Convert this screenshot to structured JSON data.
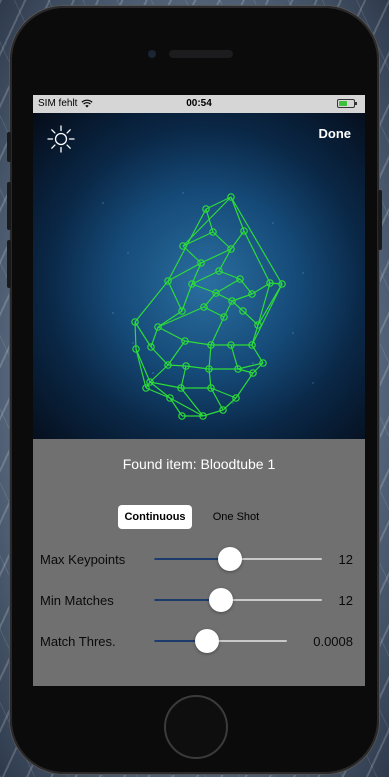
{
  "status_bar": {
    "carrier": "SIM fehlt",
    "time": "00:54"
  },
  "top_bar": {
    "brightness_icon": "sun-icon",
    "done_label": "Done"
  },
  "result": {
    "found_text": "Found item: Bloodtube 1"
  },
  "mode": {
    "options": [
      "Continuous",
      "One Shot"
    ],
    "selected": "Continuous"
  },
  "sliders": [
    {
      "label": "Max Keypoints",
      "value_text": "12",
      "fraction": 0.45
    },
    {
      "label": "Min Matches",
      "value_text": "12",
      "fraction": 0.4
    },
    {
      "label": "Match Thres.",
      "value_text": "0.0008",
      "fraction": 0.4
    }
  ],
  "colors": {
    "mesh": "#2ddb3a",
    "slider_fill": "#1d3b6a",
    "panel": "#707070"
  }
}
